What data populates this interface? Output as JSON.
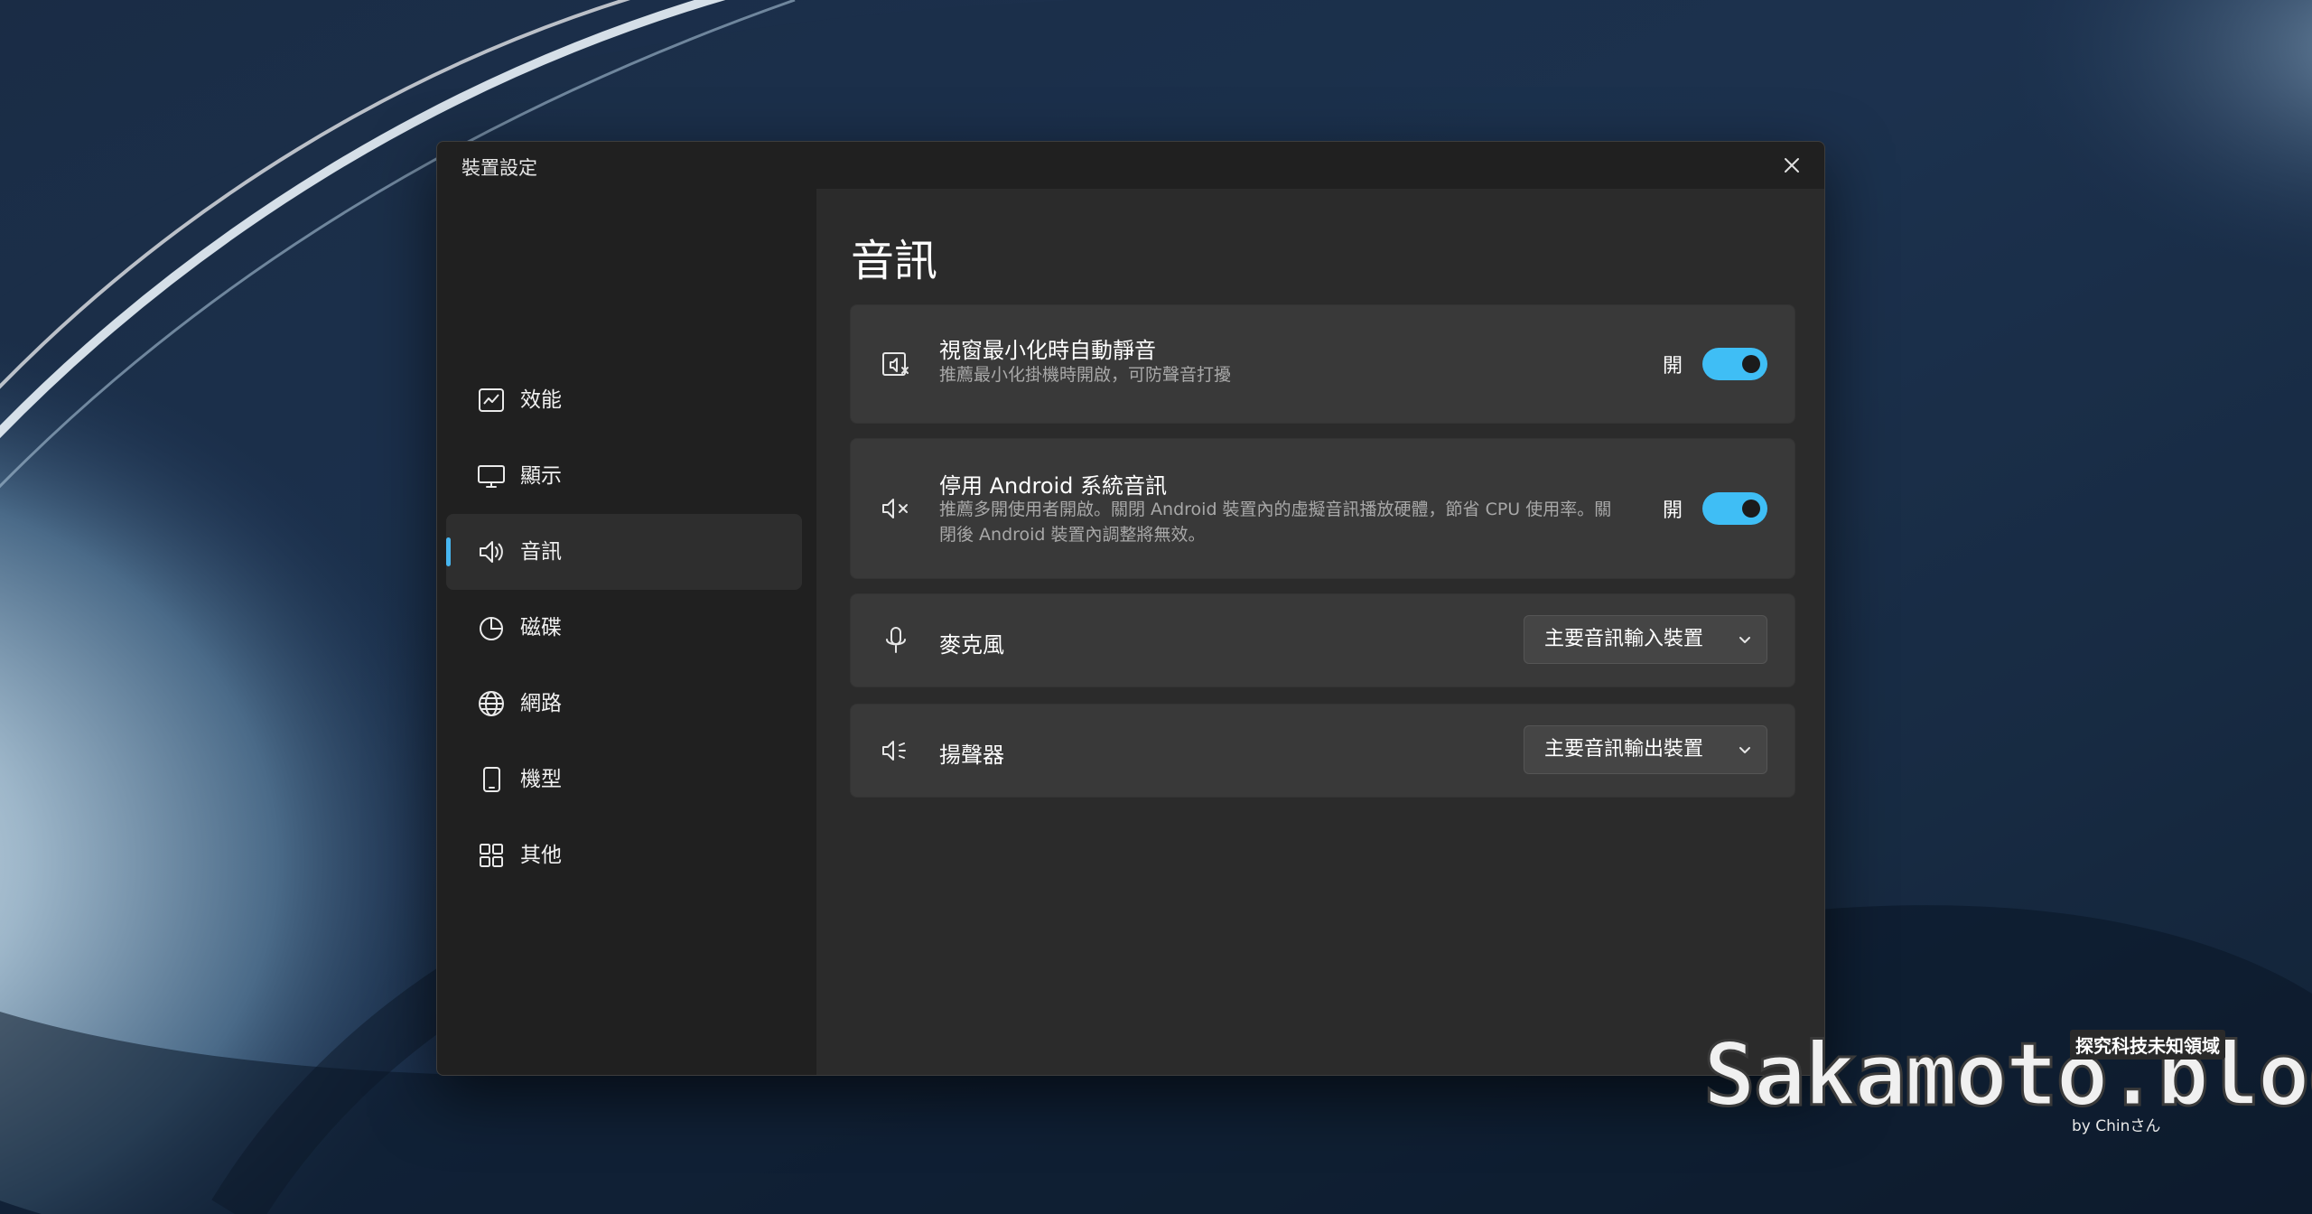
{
  "window": {
    "title": "裝置設定"
  },
  "sidebar": {
    "items": [
      {
        "label": "效能",
        "icon": "performance-chart-icon",
        "active": false
      },
      {
        "label": "顯示",
        "icon": "monitor-icon",
        "active": false
      },
      {
        "label": "音訊",
        "icon": "speaker-icon",
        "active": true
      },
      {
        "label": "磁碟",
        "icon": "disk-pie-icon",
        "active": false
      },
      {
        "label": "網路",
        "icon": "globe-icon",
        "active": false
      },
      {
        "label": "機型",
        "icon": "phone-icon",
        "active": false
      },
      {
        "label": "其他",
        "icon": "grid-apps-icon",
        "active": false
      }
    ]
  },
  "main": {
    "page_title": "音訊",
    "cards": [
      {
        "icon": "minimize-mute-icon",
        "title": "視窗最小化時自動靜音",
        "desc": "推薦最小化掛機時開啟，可防聲音打擾",
        "state_label": "開",
        "toggle_on": true
      },
      {
        "icon": "speaker-mute-icon",
        "title": "停用 Android 系統音訊",
        "desc": "推薦多開使用者開啟。關閉 Android 裝置內的虛擬音訊播放硬體，節省 CPU 使用率。關閉後 Android 裝置內調整將無效。",
        "state_label": "開",
        "toggle_on": true
      },
      {
        "icon": "microphone-icon",
        "title": "麥克風",
        "dropdown": "主要音訊輸入裝置"
      },
      {
        "icon": "speaker-volume-icon",
        "title": "揚聲器",
        "dropdown": "主要音訊輸出裝置"
      }
    ]
  },
  "watermark": {
    "text": "Sakamoto.blog",
    "tag": "探究科技未知領域",
    "byline": "by Chinさん"
  },
  "colors": {
    "accent": "#3fbef5",
    "window_bg": "#202020",
    "content_bg": "#2b2b2b",
    "card_bg": "#393939"
  }
}
